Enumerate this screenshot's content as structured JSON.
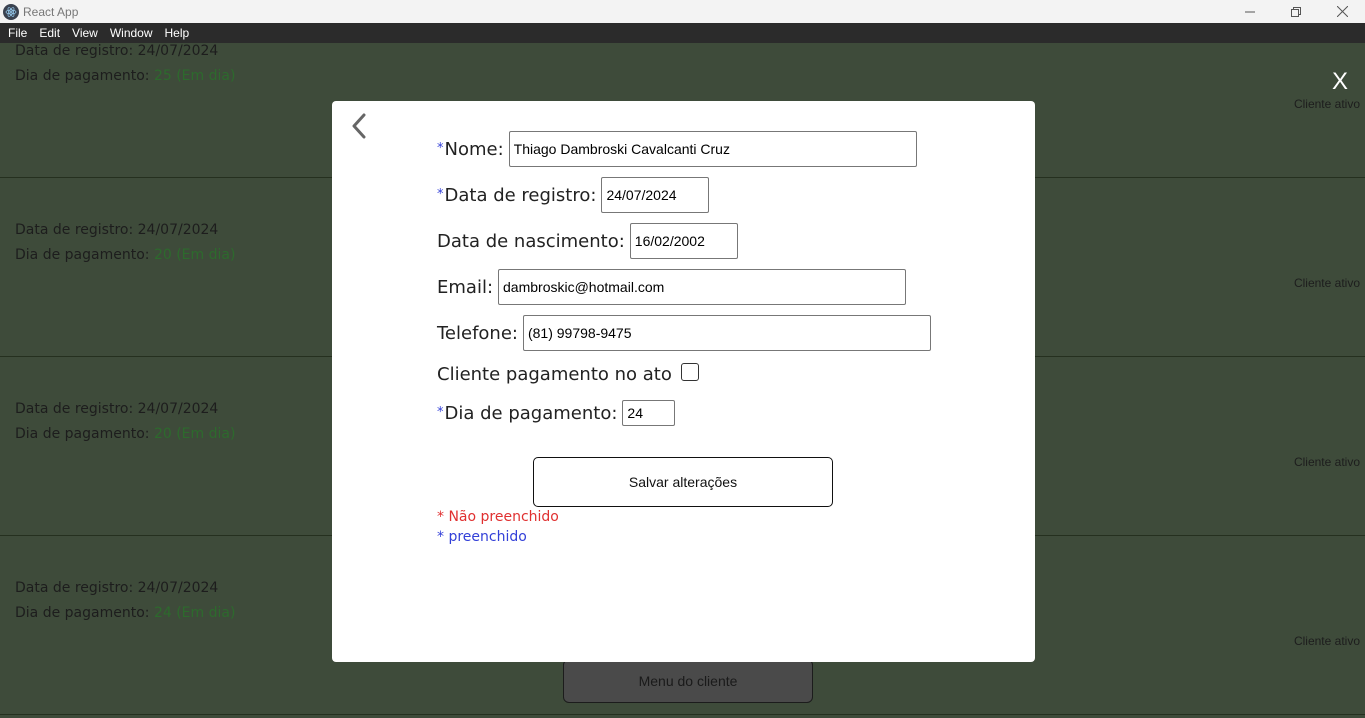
{
  "window": {
    "title": "React App",
    "minimize_icon": "minimize-icon",
    "restore_icon": "restore-icon",
    "close_icon": "close-icon"
  },
  "menubar": {
    "items": [
      "File",
      "Edit",
      "View",
      "Window",
      "Help"
    ]
  },
  "background": {
    "close_label": "X",
    "cards": [
      {
        "registro_label": "Data de registro:",
        "registro_value": "24/07/2024",
        "pagamento_label": "Dia de pagamento:",
        "pagamento_value": "25 (Em dia)",
        "badge": "Cliente ativo"
      },
      {
        "registro_label": "Data de registro:",
        "registro_value": "24/07/2024",
        "pagamento_label": "Dia de pagamento:",
        "pagamento_value": "20 (Em dia)",
        "badge": "Cliente ativo"
      },
      {
        "registro_label": "Data de registro:",
        "registro_value": "24/07/2024",
        "pagamento_label": "Dia de pagamento:",
        "pagamento_value": "20 (Em dia)",
        "badge": "Cliente ativo"
      },
      {
        "registro_label": "Data de registro:",
        "registro_value": "24/07/2024",
        "pagamento_label": "Dia de pagamento:",
        "pagamento_value": "24 (Em dia)",
        "badge": "Cliente ativo"
      }
    ],
    "menu_cliente_label": "Menu do cliente"
  },
  "modal": {
    "back_icon": "chevron-left-icon",
    "required_mark": "*",
    "fields": {
      "nome": {
        "label": "Nome:",
        "value": "Thiago Dambroski Cavalcanti Cruz"
      },
      "data_registro": {
        "label": "Data de registro:",
        "value": "24/07/2024"
      },
      "data_nascimento": {
        "label": "Data de nascimento:",
        "value": "16/02/2002"
      },
      "email": {
        "label": "Email:",
        "value": "dambroskic@hotmail.com"
      },
      "telefone": {
        "label": "Telefone:",
        "value": "(81) 99798-9475"
      },
      "pagamento_no_ato": {
        "label": "Cliente pagamento no ato",
        "checked": false
      },
      "dia_pagamento": {
        "label": "Dia de pagamento:",
        "value": "24"
      }
    },
    "save_label": "Salvar alterações",
    "legend": {
      "empty": "* Não preenchido",
      "filled": "* preenchido"
    }
  },
  "colors": {
    "background": "#3e4b3a",
    "filled_mark": "#3340d8",
    "empty_mark": "#e03030",
    "status_ok": "#2d6a2d"
  }
}
